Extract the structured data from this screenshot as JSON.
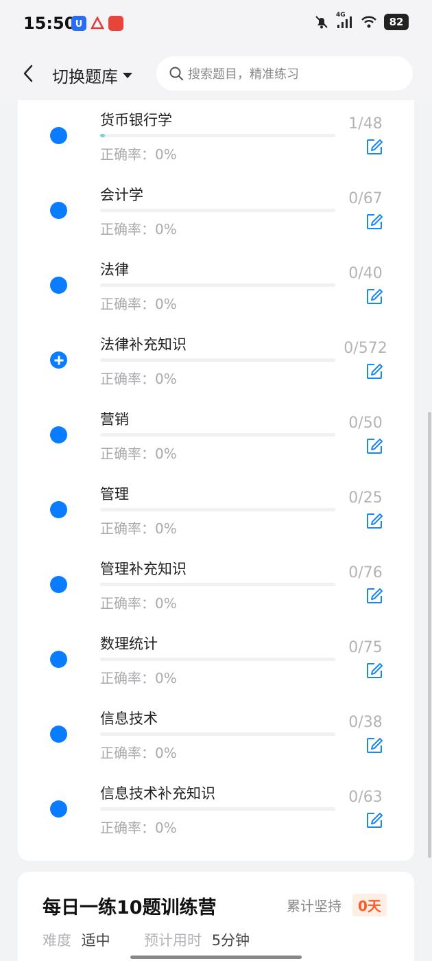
{
  "status_bar": {
    "time": "15:50",
    "network": "4G",
    "battery": "82"
  },
  "header": {
    "back_icon": "chevron-left-icon",
    "switch_label": "切换题库",
    "search_placeholder": "搜索题目，精准练习"
  },
  "accuracy_label": "正确率：",
  "items": [
    {
      "name": "货币银行学",
      "count": "1/48",
      "accuracy": "0%",
      "progress": 0.02,
      "expandable": false
    },
    {
      "name": "会计学",
      "count": "0/67",
      "accuracy": "0%",
      "progress": 0,
      "expandable": false
    },
    {
      "name": "法律",
      "count": "0/40",
      "accuracy": "0%",
      "progress": 0,
      "expandable": false
    },
    {
      "name": "法律补充知识",
      "count": "0/572",
      "accuracy": "0%",
      "progress": 0,
      "expandable": true
    },
    {
      "name": "营销",
      "count": "0/50",
      "accuracy": "0%",
      "progress": 0,
      "expandable": false
    },
    {
      "name": "管理",
      "count": "0/25",
      "accuracy": "0%",
      "progress": 0,
      "expandable": false
    },
    {
      "name": "管理补充知识",
      "count": "0/76",
      "accuracy": "0%",
      "progress": 0,
      "expandable": false
    },
    {
      "name": "数理统计",
      "count": "0/75",
      "accuracy": "0%",
      "progress": 0,
      "expandable": false
    },
    {
      "name": "信息技术",
      "count": "0/38",
      "accuracy": "0%",
      "progress": 0,
      "expandable": false
    },
    {
      "name": "信息技术补充知识",
      "count": "0/63",
      "accuracy": "0%",
      "progress": 0,
      "expandable": false
    }
  ],
  "daily": {
    "title": "每日一练10题训练营",
    "streak_label": "累计坚持",
    "streak_value": "0天",
    "difficulty_label": "难度",
    "difficulty_value": "适中",
    "time_label": "预计用时",
    "time_value": "5分钟"
  },
  "colors": {
    "accent": "#0a7cff",
    "progress_fill": "#7fd0d6",
    "streak": "#ff5a1f"
  }
}
